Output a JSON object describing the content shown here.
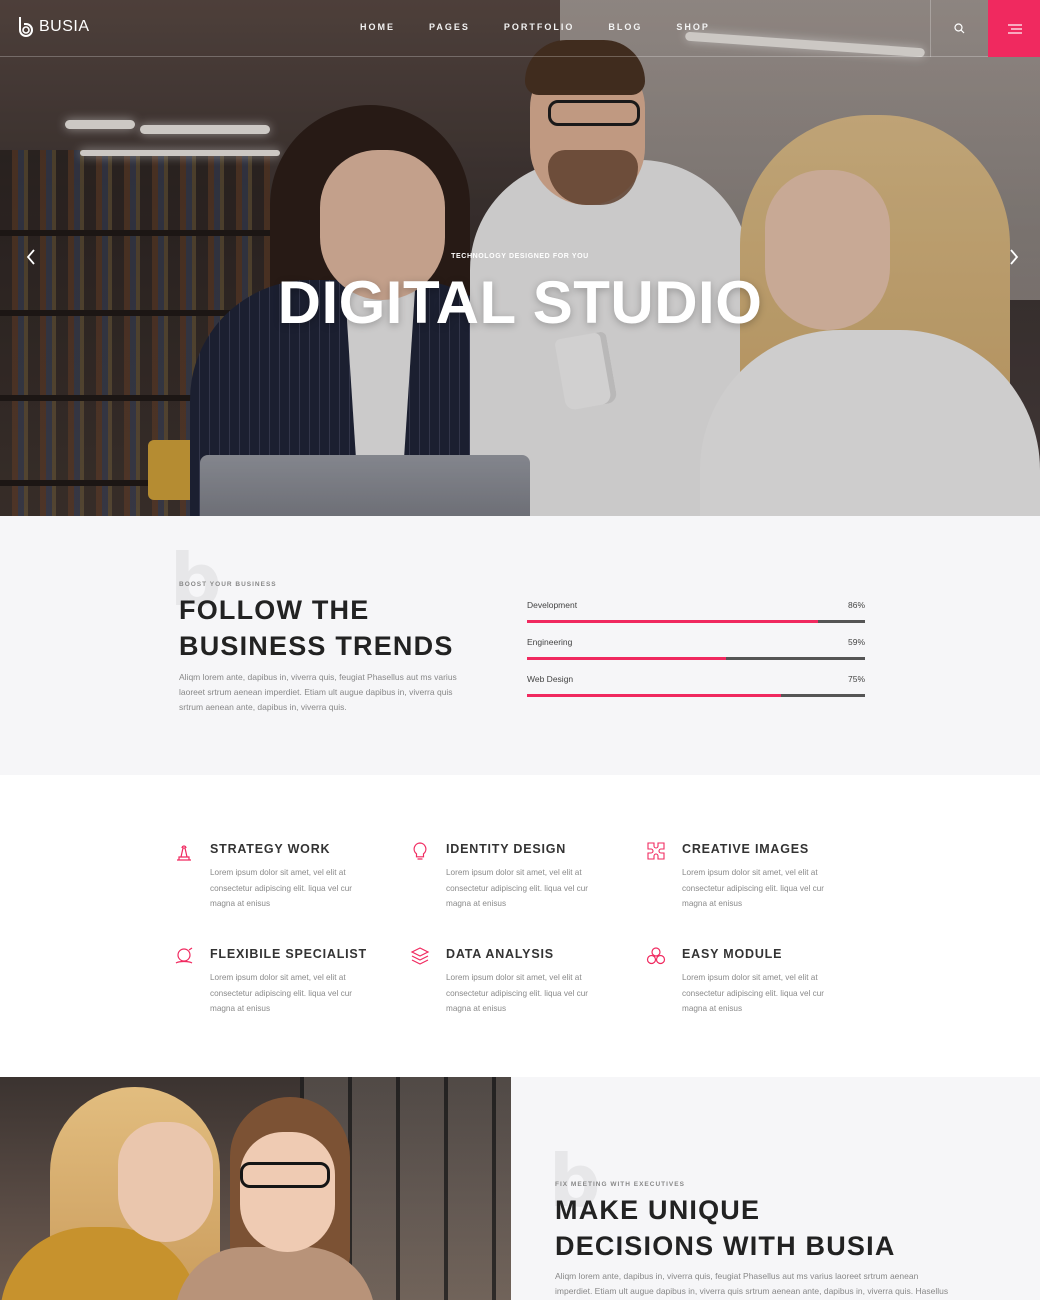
{
  "brand": {
    "name": "BUSIA"
  },
  "nav": {
    "items": [
      "HOME",
      "PAGES",
      "PORTFOLIO",
      "BLOG",
      "SHOP"
    ]
  },
  "hero": {
    "kicker": "TECHNOLOGY DESIGNED FOR YOU",
    "title": "DIGITAL STUDIO"
  },
  "trends": {
    "kicker": "BOOST YOUR BUSINESS",
    "title_line1": "FOLLOW THE",
    "title_line2": "BUSINESS TRENDS",
    "text": "Aliqm lorem ante, dapibus in, viverra quis, feugiat Phasellus aut ms varius laoreet srtrum aenean imperdiet. Etiam ult augue dapibus in, viverra quis srtrum aenean ante, dapibus in, viverra quis.",
    "skills": [
      {
        "label": "Development",
        "pct_text": "86%",
        "value": 0.86
      },
      {
        "label": "Engineering",
        "pct_text": "59%",
        "value": 0.59
      },
      {
        "label": "Web Design",
        "pct_text": "75%",
        "value": 0.75
      }
    ]
  },
  "features": [
    {
      "title": "STRATEGY WORK",
      "icon": "strategy-icon",
      "text": "Lorem ipsum dolor sit amet, vel elit at consectetur adipiscing elit. liqua vel cur magna at enisus"
    },
    {
      "title": "IDENTITY DESIGN",
      "icon": "lightbulb-icon",
      "text": "Lorem ipsum dolor sit amet, vel elit at consectetur adipiscing elit. liqua vel cur magna at enisus"
    },
    {
      "title": "CREATIVE IMAGES",
      "icon": "puzzle-icon",
      "text": "Lorem ipsum dolor sit amet, vel elit at consectetur adipiscing elit. liqua vel cur magna at enisus"
    },
    {
      "title": "FLEXIBILE SPECIALIST",
      "icon": "specialist-icon",
      "text": "Lorem ipsum dolor sit amet, vel elit at consectetur adipiscing elit. liqua vel cur magna at enisus"
    },
    {
      "title": "DATA ANALYSIS",
      "icon": "layers-icon",
      "text": "Lorem ipsum dolor sit amet, vel elit at consectetur adipiscing elit. liqua vel cur magna at enisus"
    },
    {
      "title": "EASY MODULE",
      "icon": "module-icon",
      "text": "Lorem ipsum dolor sit amet, vel elit at consectetur adipiscing elit. liqua vel cur magna at enisus"
    }
  ],
  "meeting": {
    "kicker": "FIX MEETING WITH EXECUTIVES",
    "title_line1": "MAKE UNIQUE",
    "title_line2": "DECISIONS WITH BUSIA",
    "text": "Aliqm lorem ante, dapibus in, viverra quis, feugiat Phasellus aut ms varius laoreet srtrum aenean imperdiet. Etiam ult augue dapibus in, viverra quis srtrum aenean ante, dapibus in, viverra quis. Hasellus aut ms"
  },
  "colors": {
    "accent": "#f0295f",
    "section_bg": "#f6f6f8",
    "title": "#222222",
    "muted": "#888888"
  }
}
